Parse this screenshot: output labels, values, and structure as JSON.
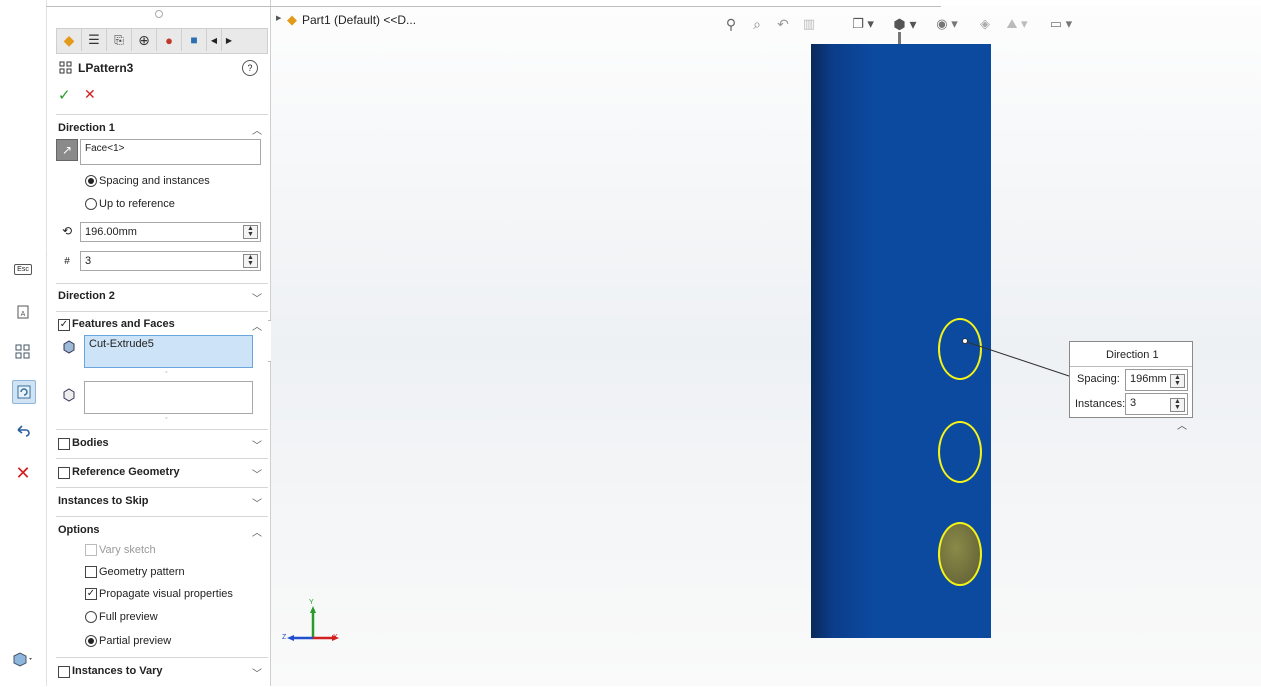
{
  "pm": {
    "feature_name": "LPattern3",
    "help_icon": "?",
    "ok": "✓",
    "cancel": "✕",
    "direction1": {
      "header": "Direction 1",
      "direction_ref": "Face<1>",
      "radio_spacing": "Spacing and instances",
      "radio_upto": "Up to reference",
      "spacing_value": "196.00mm",
      "instances_value": "3"
    },
    "direction2": {
      "header": "Direction 2"
    },
    "features_faces": {
      "header": "Features and Faces",
      "feature_item": "Cut-Extrude5"
    },
    "bodies": {
      "header": "Bodies"
    },
    "ref_geometry": {
      "header": "Reference Geometry"
    },
    "instances_to_skip": {
      "header": "Instances to Skip"
    },
    "options": {
      "header": "Options",
      "vary_sketch": "Vary sketch",
      "geometry_pattern": "Geometry pattern",
      "propagate": "Propagate visual properties",
      "full_preview": "Full preview",
      "partial_preview": "Partial preview"
    },
    "instances_to_vary": {
      "header": "Instances to Vary"
    }
  },
  "strip": {
    "esc_label": "Esc"
  },
  "viewport": {
    "tree_label": "Part1 (Default) <<D...",
    "callout": {
      "title": "Direction 1",
      "spacing_label": "Spacing:",
      "spacing_value": "196mm",
      "instances_label": "Instances:",
      "instances_value": "3"
    },
    "axes": {
      "x": "X",
      "y": "Y",
      "z": "Z"
    }
  },
  "colors": {
    "part_blue": "#0b4a9f",
    "hole_highlight": "#f3f318",
    "ok_green": "#2a9a2a",
    "cancel_red": "#d02020"
  }
}
